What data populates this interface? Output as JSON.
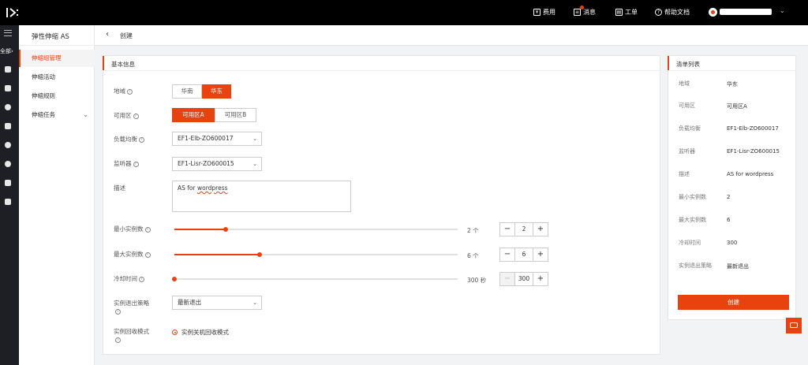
{
  "topbar": {
    "logo": "/>:",
    "items": [
      {
        "label": "费用",
        "icon": "bill-icon"
      },
      {
        "label": "消息",
        "icon": "message-icon"
      },
      {
        "label": "工单",
        "icon": "ticket-icon"
      },
      {
        "label": "帮助文档",
        "icon": "help-icon"
      }
    ]
  },
  "iconbar": {
    "all_label": "全部"
  },
  "sidebar": {
    "title": "弹性伸缩 AS",
    "items": [
      {
        "label": "伸缩组管理",
        "active": true
      },
      {
        "label": "伸缩活动"
      },
      {
        "label": "伸缩规则"
      },
      {
        "label": "伸缩任务",
        "expandable": true
      }
    ]
  },
  "breadcrumb": {
    "back": "‹",
    "title": "创建"
  },
  "form": {
    "section_title": "基本信息",
    "region": {
      "label": "地域",
      "options": [
        "华南",
        "华东"
      ],
      "selected": "华东"
    },
    "zone": {
      "label": "可用区",
      "options": [
        "可用区A",
        "可用区B"
      ],
      "selected": "可用区A"
    },
    "lb": {
      "label": "负载均衡",
      "value": "EF1-Elb-ZO600017"
    },
    "listener": {
      "label": "监听器",
      "value": "EF1-Lisr-ZO600015"
    },
    "desc": {
      "label": "描述",
      "value_prefix": "AS for ",
      "value_word": "wordpress"
    },
    "min": {
      "label": "最小实例数",
      "value": "2",
      "unit_text": "2 个",
      "fraction": 0.18
    },
    "max": {
      "label": "最大实例数",
      "value": "6",
      "unit_text": "6 个",
      "fraction": 0.3
    },
    "cooldown": {
      "label": "冷却时间",
      "value": "300",
      "unit_text": "300 秒",
      "fraction": 0.0
    },
    "exit_policy": {
      "label": "实例退出策略",
      "value": "最新退出"
    },
    "recycle": {
      "label": "实例回收模式",
      "value": "实例关机回收模式"
    }
  },
  "summary": {
    "title": "清单列表",
    "rows": [
      {
        "label": "地域",
        "value": "华东"
      },
      {
        "label": "可用区",
        "value": "可用区A"
      },
      {
        "label": "负载均衡",
        "value": "EF1-Elb-ZO600017"
      },
      {
        "label": "监听器",
        "value": "EF1-Lisr-ZO600015"
      },
      {
        "label": "描述",
        "value": "AS for wordpress"
      },
      {
        "label": "最小实例数",
        "value": "2"
      },
      {
        "label": "最大实例数",
        "value": "6"
      },
      {
        "label": "冷却时间",
        "value": "300"
      },
      {
        "label": "实例退出策略",
        "value": "最新退出"
      }
    ],
    "create_label": "创建"
  },
  "colors": {
    "accent": "#e8430f",
    "topbar": "#000000",
    "iconbar": "#1d1f24"
  }
}
